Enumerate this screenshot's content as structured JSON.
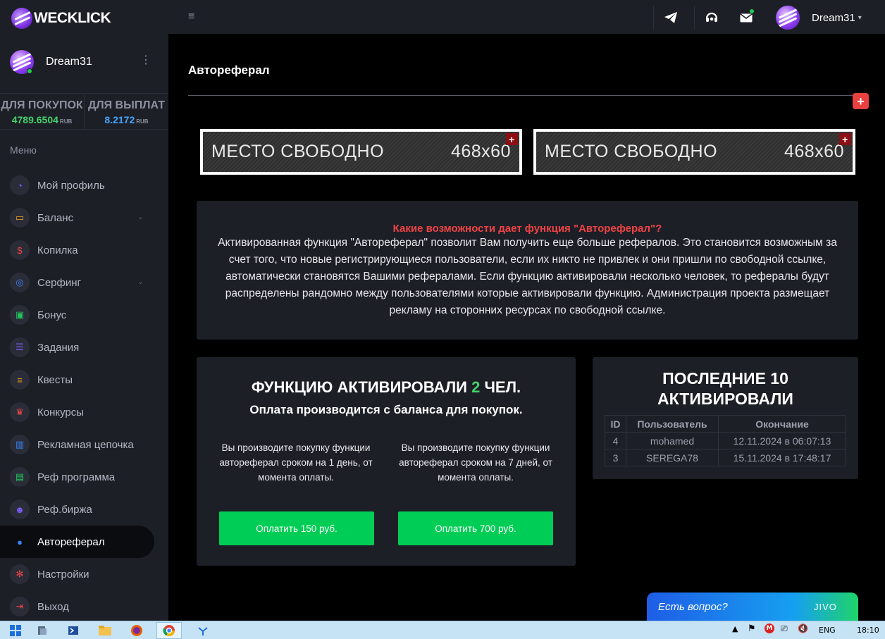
{
  "brand": {
    "name": "WECKLICK"
  },
  "sidebar": {
    "user_name": "Dream31",
    "balances": [
      {
        "title": "ДЛЯ ПОКУПОК",
        "value": "4789.6504",
        "currency": "RUB",
        "color": "#43d36a"
      },
      {
        "title": "ДЛЯ ВЫПЛАТ",
        "value": "8.2172",
        "currency": "RUB",
        "color": "#44a5ff"
      }
    ],
    "menu_title": "Меню",
    "items": [
      {
        "label": "Мой профиль",
        "icon": "dashboard-icon",
        "color": "#7c5cff"
      },
      {
        "label": "Баланс",
        "icon": "laptop-icon",
        "color": "#f0a020",
        "has_submenu": true
      },
      {
        "label": "Копилка",
        "icon": "dollar-icon",
        "color": "#ef4444"
      },
      {
        "label": "Серфинг",
        "icon": "fingerprint-icon",
        "color": "#3b82f6",
        "has_submenu": true
      },
      {
        "label": "Бонус",
        "icon": "gift-icon",
        "color": "#22c55e"
      },
      {
        "label": "Задания",
        "icon": "checklist-icon",
        "color": "#7c5cff"
      },
      {
        "label": "Квесты",
        "icon": "list-icon",
        "color": "#f0a020"
      },
      {
        "label": "Конкурсы",
        "icon": "trophy-icon",
        "color": "#ef4444"
      },
      {
        "label": "Рекламная цепочка",
        "icon": "bar-chart-icon",
        "color": "#3b82f6"
      },
      {
        "label": "Реф программа",
        "icon": "id-card-icon",
        "color": "#22c55e"
      },
      {
        "label": "Реф.биржа",
        "icon": "users-icon",
        "color": "#7c5cff"
      },
      {
        "label": "Автореферал",
        "icon": "user-icon",
        "color": "#3b82f6",
        "active": true
      },
      {
        "label": "Настройки",
        "icon": "gear-icon",
        "color": "#ef4444"
      },
      {
        "label": "Выход",
        "icon": "logout-icon",
        "color": "#ef4444"
      }
    ]
  },
  "topbar": {
    "user_name": "Dream31"
  },
  "page": {
    "title": "Автореферал",
    "banners": [
      {
        "text": "МЕСТО СВОБОДНО",
        "size": "468x60"
      },
      {
        "text": "МЕСТО СВОБОДНО",
        "size": "468x60"
      }
    ],
    "info": {
      "question": "Какие возможности дает функция \"Автореферал\"?",
      "text": "Активированная функция \"Автореферал\" позволит Вам получить еще больше рефералов. Это становится возможным за счет того, что новые регистрирующиеся пользователи, если их никто не привлек и они пришли по свободной ссылке, автоматически становятся Вашими рефералами. Если функцию активировали несколько человек, то рефералы будут распределены рандомно между пользователями которые активировали функцию. Администрация проекта размещает рекламу на сторонних ресурсах по свободной ссылке."
    },
    "activate": {
      "title_prefix": "ФУНКЦИЮ АКТИВИРОВАЛИ",
      "count": "2",
      "title_suffix": "ЧЕЛ.",
      "subtitle": "Оплата производится с баланса для покупок.",
      "options": [
        {
          "text": "Вы производите покупку функции автореферал сроком на 1 день, от момента оплаты.",
          "button": "Оплатить 150 руб."
        },
        {
          "text": "Вы производите покупку функции автореферал сроком на 7 дней, от момента оплаты.",
          "button": "Оплатить 700 руб."
        }
      ]
    },
    "last": {
      "title_line1": "ПОСЛЕДНИЕ 10",
      "title_line2": "АКТИВИРОВАЛИ",
      "columns": [
        "ID",
        "Пользователь",
        "Окончание"
      ],
      "rows": [
        [
          "4",
          "mohamed",
          "12.11.2024 в 06:07:13"
        ],
        [
          "3",
          "SEREGA78",
          "15.11.2024 в 17:48:17"
        ]
      ]
    }
  },
  "chat": {
    "label": "Есть вопрос?",
    "brand": "JIVO"
  },
  "taskbar": {
    "lang": "ENG",
    "time": "18:10"
  }
}
